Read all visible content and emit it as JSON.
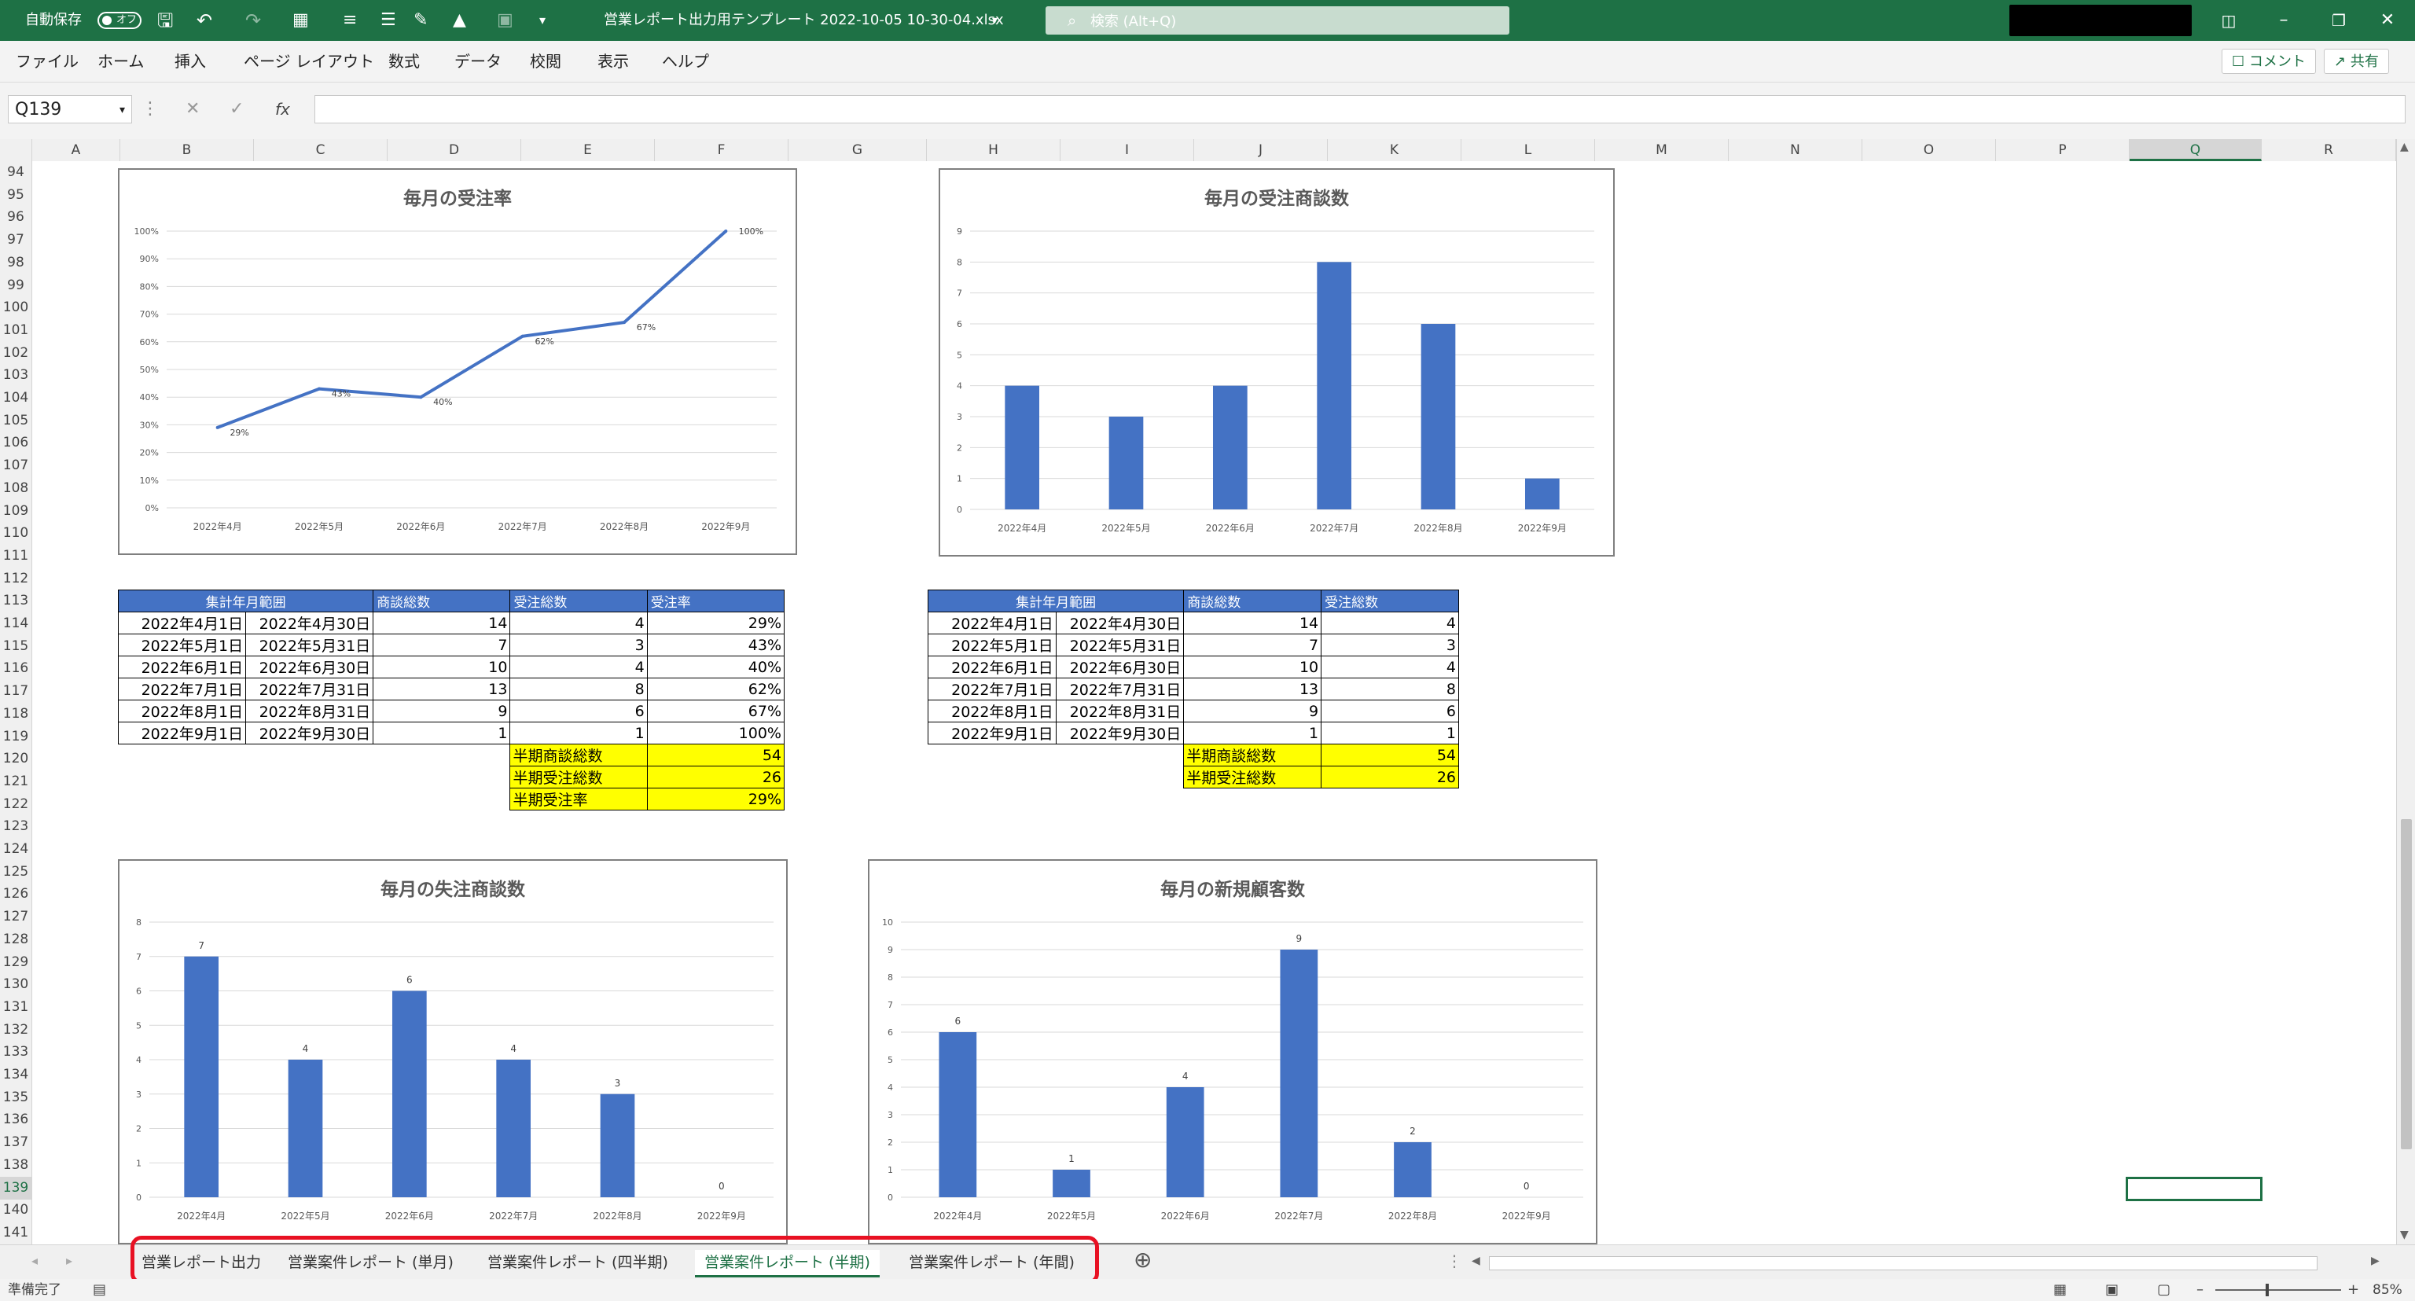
{
  "titlebar": {
    "autosave_label": "自動保存",
    "autosave_state": "オフ",
    "filename": "営業レポート出力用テンプレート 2022-10-05 10-30-04.xlsx",
    "search_placeholder": "検索 (Alt+Q)"
  },
  "menu": {
    "items": [
      "ファイル",
      "ホーム",
      "挿入",
      "ページ レイアウト",
      "数式",
      "データ",
      "校閲",
      "表示",
      "ヘルプ"
    ],
    "comment_label": "コメント",
    "share_label": "共有"
  },
  "formula": {
    "namebox": "Q139",
    "content": ""
  },
  "grid": {
    "columns": [
      "A",
      "B",
      "C",
      "D",
      "E",
      "F",
      "G",
      "H",
      "I",
      "J",
      "K",
      "L",
      "M",
      "N",
      "O",
      "P",
      "Q",
      "R"
    ],
    "rows": [
      "94",
      "95",
      "96",
      "97",
      "98",
      "99",
      "100",
      "101",
      "102",
      "103",
      "104",
      "105",
      "106",
      "107",
      "108",
      "109",
      "110",
      "111",
      "112",
      "113",
      "114",
      "115",
      "116",
      "117",
      "118",
      "119",
      "120",
      "121",
      "122",
      "123",
      "124",
      "125",
      "126",
      "127",
      "128",
      "129",
      "130",
      "131",
      "132",
      "133",
      "134",
      "135",
      "136",
      "137",
      "138",
      "139",
      "140",
      "141"
    ]
  },
  "chart_data": [
    {
      "type": "line",
      "title": "毎月の受注率",
      "categories": [
        "2022年4月",
        "2022年5月",
        "2022年6月",
        "2022年7月",
        "2022年8月",
        "2022年9月"
      ],
      "values": [
        29,
        43,
        40,
        62,
        67,
        100
      ],
      "data_labels": [
        "29%",
        "43%",
        "40%",
        "62%",
        "67%",
        "100%"
      ],
      "yticks": [
        "0%",
        "10%",
        "20%",
        "30%",
        "40%",
        "50%",
        "60%",
        "70%",
        "80%",
        "90%",
        "100%"
      ],
      "ylim": [
        0,
        100
      ],
      "color": "#4472c4"
    },
    {
      "type": "bar",
      "title": "毎月の受注商談数",
      "categories": [
        "2022年4月",
        "2022年5月",
        "2022年6月",
        "2022年7月",
        "2022年8月",
        "2022年9月"
      ],
      "values": [
        4,
        3,
        4,
        8,
        6,
        1
      ],
      "yticks": [
        "0",
        "1",
        "2",
        "3",
        "4",
        "5",
        "6",
        "7",
        "8",
        "9"
      ],
      "ylim": [
        0,
        9
      ],
      "color": "#4472c4"
    },
    {
      "type": "bar",
      "title": "毎月の失注商談数",
      "categories": [
        "2022年4月",
        "2022年5月",
        "2022年6月",
        "2022年7月",
        "2022年8月",
        "2022年9月"
      ],
      "values": [
        7,
        4,
        6,
        4,
        3,
        0
      ],
      "data_labels": [
        "7",
        "4",
        "6",
        "4",
        "3",
        "0"
      ],
      "yticks": [
        "0",
        "1",
        "2",
        "3",
        "4",
        "5",
        "6",
        "7",
        "8"
      ],
      "ylim": [
        0,
        8
      ],
      "color": "#4472c4"
    },
    {
      "type": "bar",
      "title": "毎月の新規顧客数",
      "categories": [
        "2022年4月",
        "2022年5月",
        "2022年6月",
        "2022年7月",
        "2022年8月",
        "2022年9月"
      ],
      "values": [
        6,
        1,
        4,
        9,
        2,
        0
      ],
      "data_labels": [
        "6",
        "1",
        "4",
        "9",
        "2",
        "0"
      ],
      "yticks": [
        "0",
        "1",
        "2",
        "3",
        "4",
        "5",
        "6",
        "7",
        "8",
        "9",
        "10"
      ],
      "ylim": [
        0,
        10
      ],
      "color": "#4472c4"
    }
  ],
  "table1": {
    "headers": [
      "集計年月範囲",
      "",
      "商談総数",
      "受注総数",
      "受注率"
    ],
    "rows": [
      [
        "2022年4月1日",
        "2022年4月30日",
        "14",
        "4",
        "29%"
      ],
      [
        "2022年5月1日",
        "2022年5月31日",
        "7",
        "3",
        "43%"
      ],
      [
        "2022年6月1日",
        "2022年6月30日",
        "10",
        "4",
        "40%"
      ],
      [
        "2022年7月1日",
        "2022年7月31日",
        "13",
        "8",
        "62%"
      ],
      [
        "2022年8月1日",
        "2022年8月31日",
        "9",
        "6",
        "67%"
      ],
      [
        "2022年9月1日",
        "2022年9月30日",
        "1",
        "1",
        "100%"
      ]
    ],
    "summary": [
      {
        "label": "半期商談総数",
        "value": "54"
      },
      {
        "label": "半期受注総数",
        "value": "26"
      },
      {
        "label": "半期受注率",
        "value": "29%"
      }
    ]
  },
  "table2": {
    "headers": [
      "集計年月範囲",
      "",
      "商談総数",
      "受注総数"
    ],
    "rows": [
      [
        "2022年4月1日",
        "2022年4月30日",
        "14",
        "4"
      ],
      [
        "2022年5月1日",
        "2022年5月31日",
        "7",
        "3"
      ],
      [
        "2022年6月1日",
        "2022年6月30日",
        "10",
        "4"
      ],
      [
        "2022年7月1日",
        "2022年7月31日",
        "13",
        "8"
      ],
      [
        "2022年8月1日",
        "2022年8月31日",
        "9",
        "6"
      ],
      [
        "2022年9月1日",
        "2022年9月30日",
        "1",
        "1"
      ]
    ],
    "summary": [
      {
        "label": "半期商談総数",
        "value": "54"
      },
      {
        "label": "半期受注総数",
        "value": "26"
      }
    ]
  },
  "tabs": {
    "items": [
      "営業レポート出力",
      "営業案件レポート (単月)",
      "営業案件レポート (四半期)",
      "営業案件レポート (半期)",
      "営業案件レポート (年間)"
    ],
    "active": 3,
    "highlight_color": "#e81123"
  },
  "status": {
    "ready": "準備完了",
    "zoom": "85%"
  }
}
